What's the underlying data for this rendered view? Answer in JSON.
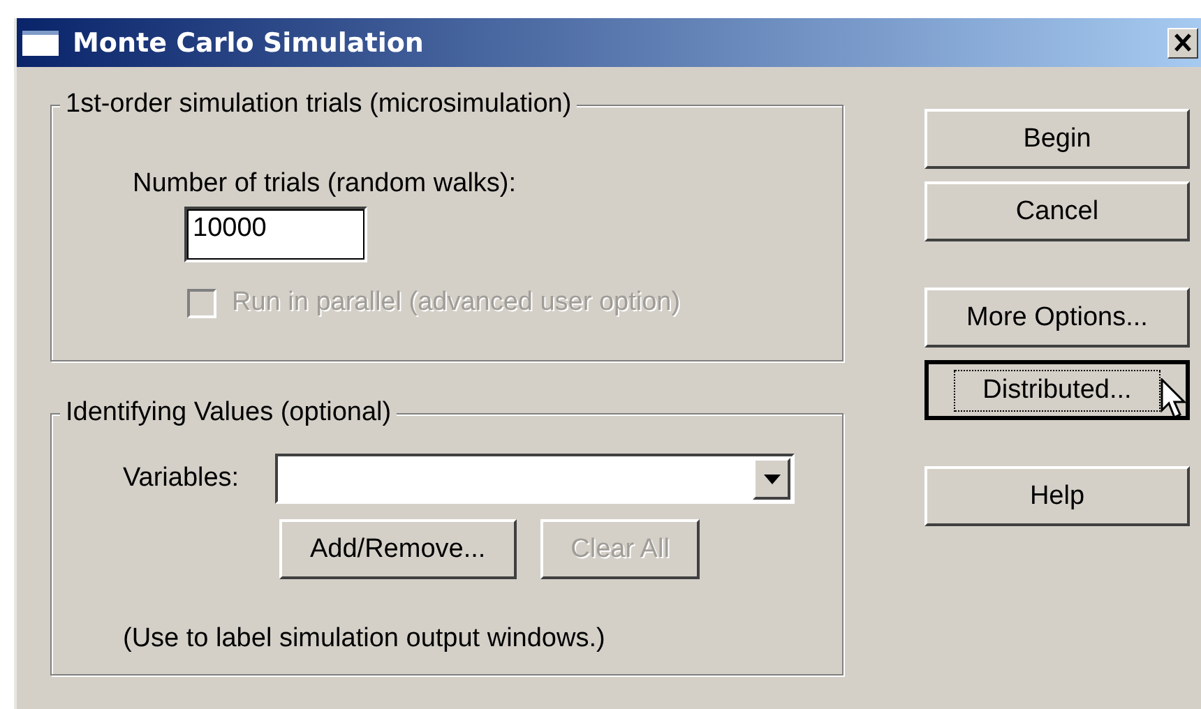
{
  "window": {
    "title": "Monte Carlo Simulation"
  },
  "trials_group": {
    "title": "1st-order simulation trials (microsimulation)",
    "trials_label": {
      "text": "Number of trials (random walks):"
    },
    "trials_value": "10000",
    "parallel": {
      "label": "Run in parallel (advanced user option)",
      "checked": false,
      "disabled": true
    }
  },
  "identifying_group": {
    "title": "Identifying Values (optional)",
    "variables_label": {
      "text": "Variables:"
    },
    "buttons": [
      {
        "label": "Add/Remove...",
        "disabled": false
      },
      {
        "label": "Clear All",
        "disabled": true
      }
    ],
    "note": "(Use to label simulation output windows.)"
  },
  "button_groups": [
    [
      {
        "label": "Begin",
        "focused": false
      },
      {
        "label": "Cancel",
        "focused": false
      }
    ],
    [
      {
        "label": "More Options...",
        "focused": false
      },
      {
        "label": "Distributed...",
        "focused": true
      }
    ],
    [
      {
        "label": "Help",
        "focused": false
      }
    ]
  ]
}
